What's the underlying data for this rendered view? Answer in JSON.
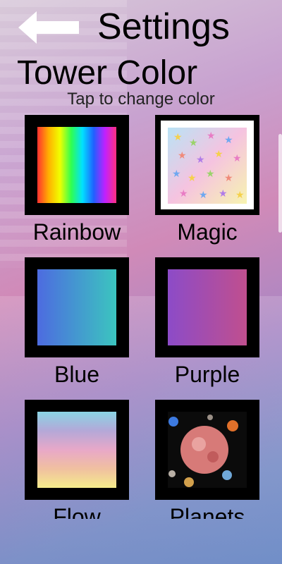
{
  "header": {
    "back_icon": "arrow-left-icon",
    "title": "Settings"
  },
  "section": {
    "title": "Tower Color",
    "hint": "Tap to change color"
  },
  "options": [
    {
      "label": "Rainbow",
      "style": "rainbow"
    },
    {
      "label": "Magic",
      "style": "magic"
    },
    {
      "label": "Blue",
      "style": "blue"
    },
    {
      "label": "Purple",
      "style": "purple"
    },
    {
      "label": "Flow",
      "style": "flow"
    },
    {
      "label": "Planets",
      "style": "planets"
    }
  ],
  "colors": {
    "frame": "#000000",
    "text": "#000000",
    "back_arrow": "#ffffff"
  }
}
